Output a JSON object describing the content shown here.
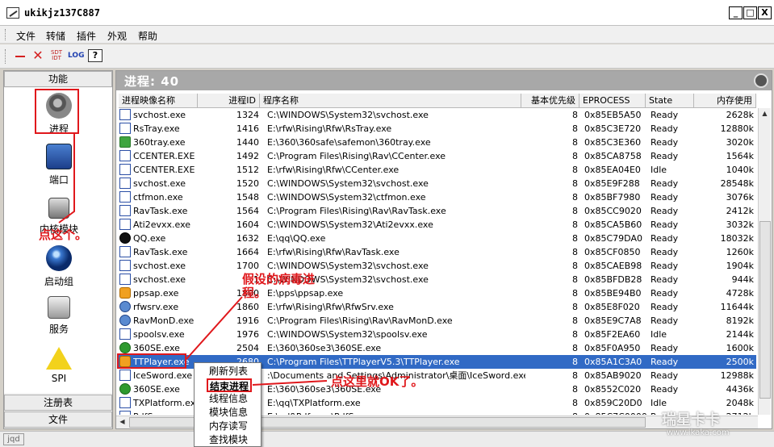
{
  "window": {
    "title": "ukikjz137C887",
    "minimize": "_",
    "maximize": "□",
    "close": "X"
  },
  "menu": [
    "文件",
    "转储",
    "插件",
    "外观",
    "帮助"
  ],
  "toolbar": {
    "icons": [
      "minus-icon",
      "delete-x-icon",
      "sdt-icon",
      "log-icon",
      "help-icon"
    ],
    "sdt_label": "SDT\nIDT",
    "log_label": "LOG",
    "help_label": "?"
  },
  "left": {
    "top_tab": "功能",
    "items": [
      {
        "label": "进程",
        "icon": "process-gear-icon"
      },
      {
        "label": "端口",
        "icon": "port-network-icon"
      },
      {
        "label": "内核模块",
        "icon": "kernel-module-icon"
      },
      {
        "label": "启动组",
        "icon": "startup-globe-icon"
      },
      {
        "label": "服务",
        "icon": "service-computer-icon"
      },
      {
        "label": "SPI",
        "icon": "warning-triangle-icon"
      }
    ],
    "bottom_tabs": [
      "注册表",
      "文件"
    ]
  },
  "process": {
    "title": "进程: 40",
    "columns": [
      "进程映像名称",
      "进程ID",
      "程序名称",
      "基本优先级",
      "EPROCESS",
      "State",
      "内存使用"
    ],
    "rows": [
      {
        "icon": "w",
        "name": "svchost.exe",
        "pid": "1324",
        "path": "C:\\WINDOWS\\System32\\svchost.exe",
        "pri": "8",
        "ep": "0x85EB5A50",
        "state": "Ready",
        "mem": "2628k"
      },
      {
        "icon": "w",
        "name": "RsTray.exe",
        "pid": "1416",
        "path": "E:\\rfw\\Rising\\Rfw\\RsTray.exe",
        "pri": "8",
        "ep": "0x85C3E720",
        "state": "Ready",
        "mem": "12880k"
      },
      {
        "icon": "g",
        "name": "360tray.exe",
        "pid": "1440",
        "path": "E:\\360\\360safe\\safemon\\360tray.exe",
        "pri": "8",
        "ep": "0x85C3E360",
        "state": "Ready",
        "mem": "3020k"
      },
      {
        "icon": "w",
        "name": "CCENTER.EXE",
        "pid": "1492",
        "path": "C:\\Program Files\\Rising\\Rav\\CCenter.exe",
        "pri": "8",
        "ep": "0x85CA8758",
        "state": "Ready",
        "mem": "1564k"
      },
      {
        "icon": "w",
        "name": "CCENTER.EXE",
        "pid": "1512",
        "path": "E:\\rfw\\Rising\\Rfw\\CCenter.exe",
        "pri": "8",
        "ep": "0x85EA04E0",
        "state": "Idle",
        "mem": "1040k"
      },
      {
        "icon": "w",
        "name": "svchost.exe",
        "pid": "1520",
        "path": "C:\\WINDOWS\\System32\\svchost.exe",
        "pri": "8",
        "ep": "0x85E9F288",
        "state": "Ready",
        "mem": "28548k"
      },
      {
        "icon": "w",
        "name": "ctfmon.exe",
        "pid": "1548",
        "path": "C:\\WINDOWS\\System32\\ctfmon.exe",
        "pri": "8",
        "ep": "0x85BF7980",
        "state": "Ready",
        "mem": "3076k"
      },
      {
        "icon": "w",
        "name": "RavTask.exe",
        "pid": "1564",
        "path": "C:\\Program Files\\Rising\\Rav\\RavTask.exe",
        "pri": "8",
        "ep": "0x85CC9020",
        "state": "Ready",
        "mem": "2412k"
      },
      {
        "icon": "w",
        "name": "Ati2evxx.exe",
        "pid": "1604",
        "path": "C:\\WINDOWS\\System32\\Ati2evxx.exe",
        "pri": "8",
        "ep": "0x85CA5B60",
        "state": "Ready",
        "mem": "3032k"
      },
      {
        "icon": "q",
        "name": "QQ.exe",
        "pid": "1632",
        "path": "E:\\qq\\QQ.exe",
        "pri": "8",
        "ep": "0x85C79DA0",
        "state": "Ready",
        "mem": "18032k"
      },
      {
        "icon": "w",
        "name": "RavTask.exe",
        "pid": "1664",
        "path": "E:\\rfw\\Rising\\Rfw\\RavTask.exe",
        "pri": "8",
        "ep": "0x85CF0850",
        "state": "Ready",
        "mem": "1260k"
      },
      {
        "icon": "w",
        "name": "svchost.exe",
        "pid": "1700",
        "path": "C:\\WINDOWS\\System32\\svchost.exe",
        "pri": "8",
        "ep": "0x85CAEB98",
        "state": "Ready",
        "mem": "1904k"
      },
      {
        "icon": "w",
        "name": "svchost.exe",
        "pid": "1",
        "path": "C:\\WINDOWS\\System32\\svchost.exe",
        "pri": "8",
        "ep": "0x85BFDB28",
        "state": "Ready",
        "mem": "944k"
      },
      {
        "icon": "o",
        "name": "ppsap.exe",
        "pid": "1800",
        "path": "E:\\pps\\ppsap.exe",
        "pri": "8",
        "ep": "0x85BE94B0",
        "state": "Ready",
        "mem": "4728k"
      },
      {
        "icon": "m",
        "name": "rfwsrv.exe",
        "pid": "1860",
        "path": "E:\\rfw\\Rising\\Rfw\\RfwSrv.exe",
        "pri": "8",
        "ep": "0x85E8F020",
        "state": "Ready",
        "mem": "11644k"
      },
      {
        "icon": "m",
        "name": "RavMonD.exe",
        "pid": "1916",
        "path": "C:\\Program Files\\Rising\\Rav\\RavMonD.exe",
        "pri": "8",
        "ep": "0x85E9C7A8",
        "state": "Ready",
        "mem": "8192k"
      },
      {
        "icon": "w",
        "name": "spoolsv.exe",
        "pid": "1976",
        "path": "C:\\WINDOWS\\System32\\spoolsv.exe",
        "pri": "8",
        "ep": "0x85F2EA60",
        "state": "Idle",
        "mem": "2144k"
      },
      {
        "icon": "e",
        "name": "360SE.exe",
        "pid": "2504",
        "path": "E:\\360\\360se3\\360SE.exe",
        "pri": "8",
        "ep": "0x85F0A950",
        "state": "Ready",
        "mem": "1600k"
      },
      {
        "icon": "o",
        "name": "TTPlayer.exe",
        "pid": "2680",
        "path": "C:\\Program Files\\TTPlayerV5.3\\TTPlayer.exe",
        "pri": "8",
        "ep": "0x85A1C3A0",
        "state": "Ready",
        "mem": "2500k",
        "selected": true
      },
      {
        "icon": "w",
        "name": "IceSword.exe",
        "pid": "",
        "path": ":\\Documents and Settings\\Administrator\\桌面\\IceSword.exe",
        "pri": "8",
        "ep": "0x85AB9020",
        "state": "Ready",
        "mem": "12988k"
      },
      {
        "icon": "e",
        "name": "360SE.exe",
        "pid": "",
        "path": "E:\\360\\360se3\\360SE.exe",
        "pri": "8",
        "ep": "0x8552C020",
        "state": "Ready",
        "mem": "4436k"
      },
      {
        "icon": "w",
        "name": "TXPlatform.exe",
        "pid": "",
        "path": "E:\\qq\\TXPlatform.exe",
        "pri": "8",
        "ep": "0x859C20D0",
        "state": "Idle",
        "mem": "2048k"
      },
      {
        "icon": "w",
        "name": "PdfSaaa.exe",
        "pid": "",
        "path": "E:\\pdf\\Pdfsaaa\\PdfSaaa.exe",
        "pri": "8",
        "ep": "0x85C7C0000",
        "state": "Ready",
        "mem": "2712k"
      }
    ]
  },
  "context_menu": [
    "刷新列表",
    "结束进程",
    "线程信息",
    "模块信息",
    "内存读写",
    "查找模块"
  ],
  "annotations": {
    "click_this": "点这个。",
    "virus": "假设的病毒进程。",
    "click_here_ok": "点这里就OK了。"
  },
  "status": "jqd",
  "watermark": {
    "brand": "瑞星卡卡",
    "url": "www.ikaka.com"
  }
}
